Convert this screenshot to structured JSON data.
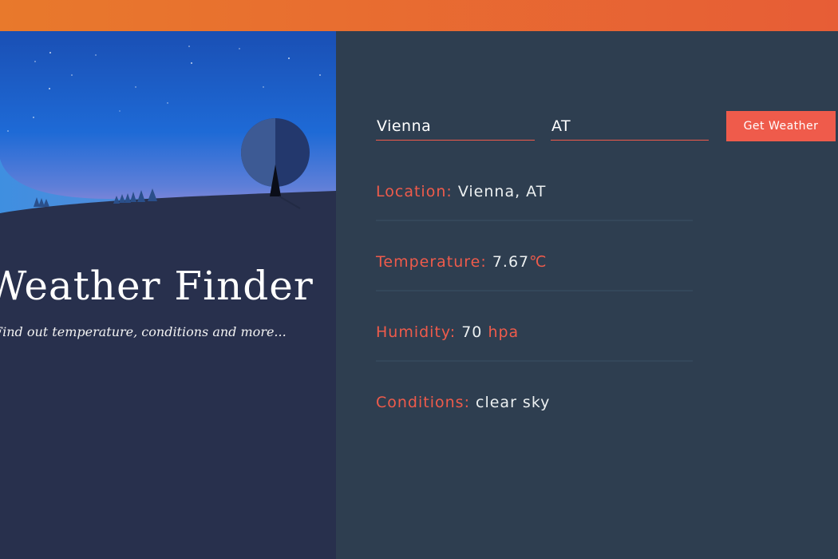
{
  "header": {
    "accent_gradient": [
      "#e8792c",
      "#e75d36"
    ]
  },
  "hero": {
    "title": "Weather Finder",
    "subtitle": "Find out temperature, conditions and more..."
  },
  "form": {
    "city_value": "Vienna",
    "country_value": "AT",
    "button_label": "Get Weather"
  },
  "results": {
    "location_label": "Location:",
    "location_value": "Vienna, AT",
    "temperature_label": "Temperature:",
    "temperature_value": "7.67",
    "temperature_unit": "℃",
    "humidity_label": "Humidity:",
    "humidity_value": "70",
    "humidity_unit": "hpa",
    "conditions_label": "Conditions:",
    "conditions_value": "clear sky"
  },
  "colors": {
    "accent": "#ef5b4b",
    "left_panel": "#28304d",
    "right_panel": "#2e3e50"
  }
}
